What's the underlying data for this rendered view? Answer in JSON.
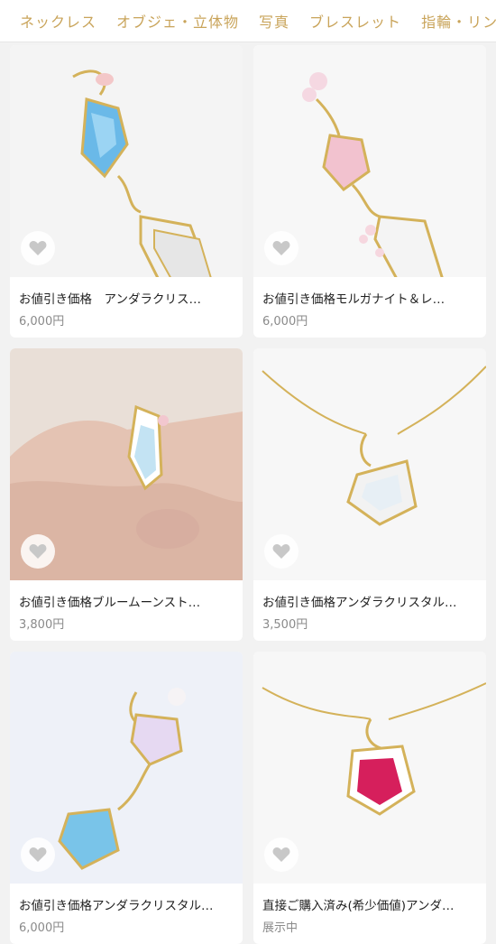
{
  "tabs": [
    "ネックレス",
    "オブジェ・立体物",
    "写真",
    "ブレスレット",
    "指輪・リン"
  ],
  "colors": {
    "accent": "#c9a45a",
    "price": "#8a8a8a"
  },
  "items": [
    {
      "title": "お値引き価格　アンダラクリス…",
      "price": "6,000円",
      "icon": "heart-icon"
    },
    {
      "title": "お値引き価格モルガナイト＆レ…",
      "price": "6,000円",
      "icon": "heart-icon"
    },
    {
      "title": "お値引き価格ブルームーンスト…",
      "price": "3,800円",
      "icon": "heart-icon"
    },
    {
      "title": "お値引き価格アンダラクリスタル…",
      "price": "3,500円",
      "icon": "heart-icon"
    },
    {
      "title": "お値引き価格アンダラクリスタル…",
      "price": "6,000円",
      "icon": "heart-icon"
    },
    {
      "title": "直接ご購入済み(希少価値)アンダ…",
      "price": "展示中",
      "icon": "heart-icon"
    }
  ]
}
